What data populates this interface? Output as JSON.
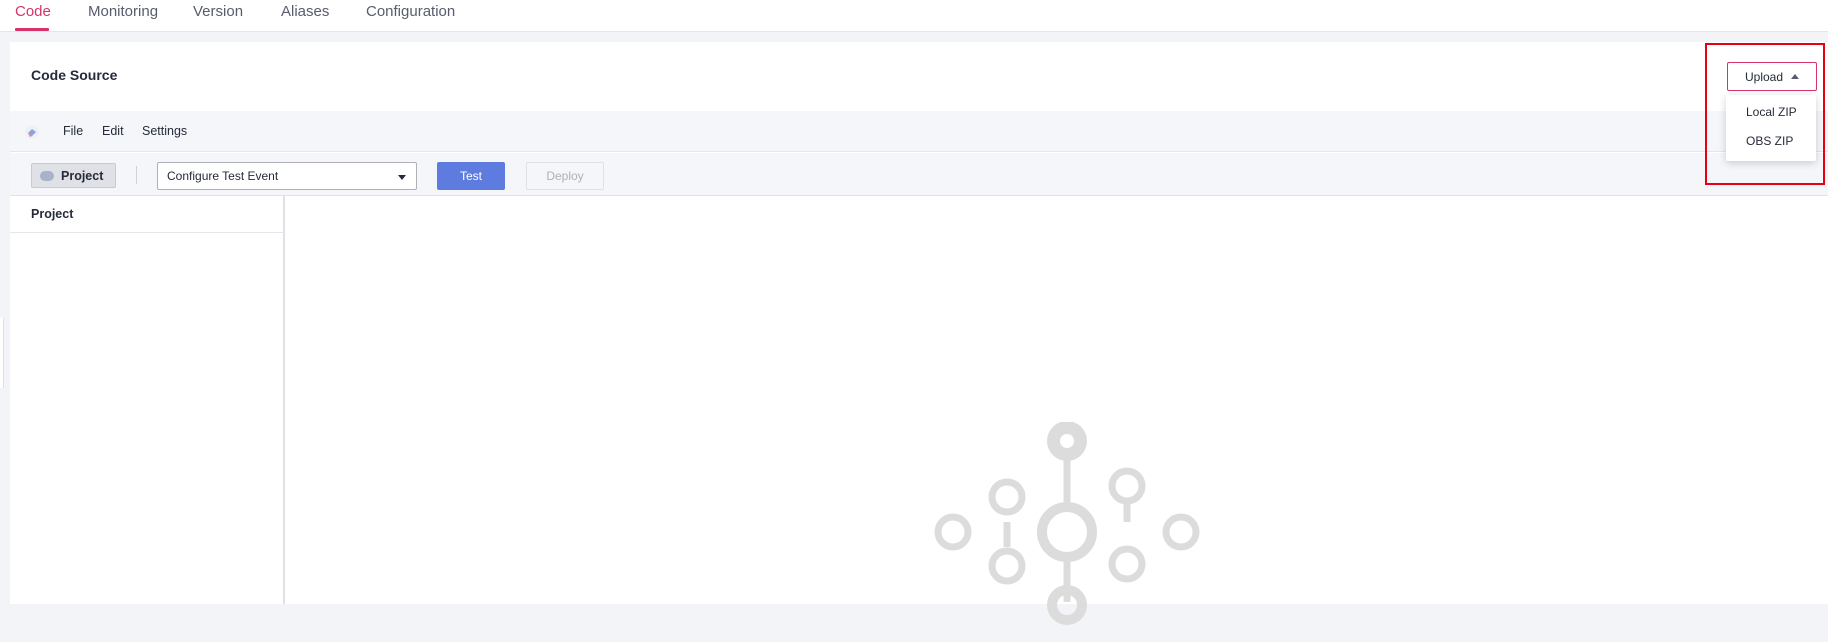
{
  "tabs": [
    {
      "label": "Code",
      "active": true
    },
    {
      "label": "Monitoring",
      "active": false
    },
    {
      "label": "Version",
      "active": false
    },
    {
      "label": "Aliases",
      "active": false
    },
    {
      "label": "Configuration",
      "active": false
    }
  ],
  "card": {
    "title": "Code Source"
  },
  "upload": {
    "label": "Upload",
    "menu": [
      "Local ZIP",
      "OBS ZIP"
    ]
  },
  "menubar": {
    "logo_icon": "editor-logo-icon",
    "items": [
      "File",
      "Edit",
      "Settings"
    ]
  },
  "toolbar": {
    "project_label": "Project",
    "event_select_value": "Configure Test Event",
    "test_label": "Test",
    "deploy_label": "Deploy"
  },
  "project_panel": {
    "title": "Project"
  },
  "colors": {
    "accent": "#d6336c",
    "primary_button": "#5e7ce0",
    "highlight": "#e60012",
    "illustration": "#dcdcdc"
  }
}
